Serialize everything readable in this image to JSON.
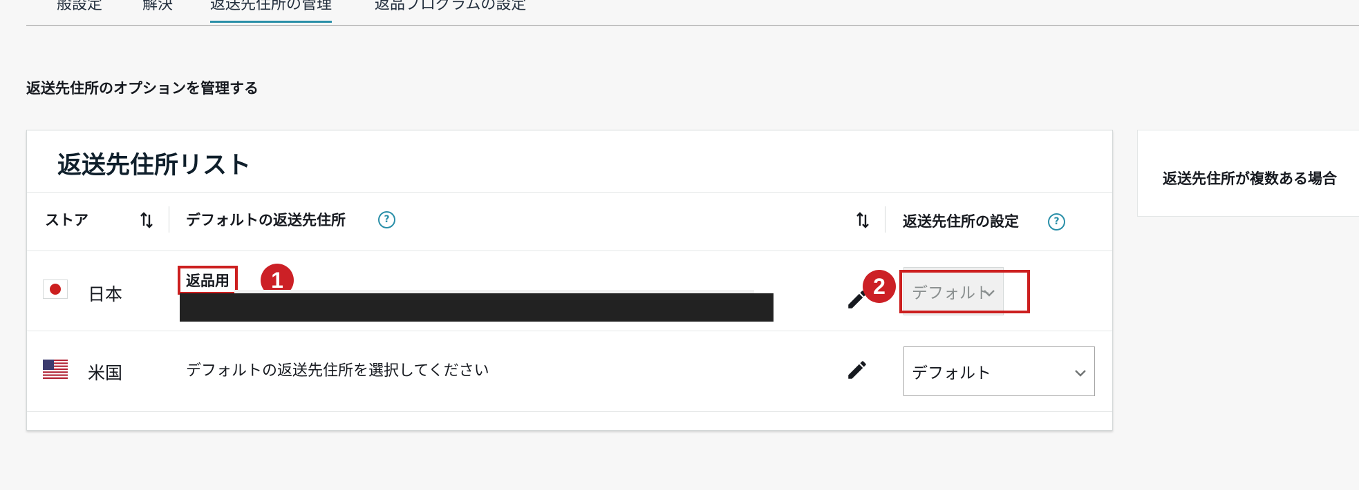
{
  "tabs": [
    {
      "label": "般設定"
    },
    {
      "label": "解決"
    },
    {
      "label": "返送先住所の管理"
    },
    {
      "label": "返品プログラムの設定"
    }
  ],
  "section_heading": "返送先住所のオプションを管理する",
  "card": {
    "title": "返送先住所リスト",
    "columns": {
      "store": "ストア",
      "default_address": "デフォルトの返送先住所",
      "address_setting": "返送先住所の設定"
    },
    "help_glyph": "?",
    "rows": [
      {
        "store": "日本",
        "flag_icon": "japan-flag-icon",
        "address_label": "返品用",
        "address_hint": "",
        "setting_value": "デフォルト",
        "setting_disabled": true
      },
      {
        "store": "米国",
        "flag_icon": "us-flag-icon",
        "address_label": "",
        "address_hint": "デフォルトの返送先住所を選択してください",
        "setting_value": "デフォルト",
        "setting_disabled": false
      }
    ]
  },
  "annotations": {
    "badge_1": "1",
    "badge_2": "2",
    "highlight_color": "#cc1f1f"
  },
  "side_card": {
    "text": "返送先住所が複数ある場合"
  },
  "colors": {
    "accent": "#2a8fa8",
    "background": "#f7f7f7"
  }
}
